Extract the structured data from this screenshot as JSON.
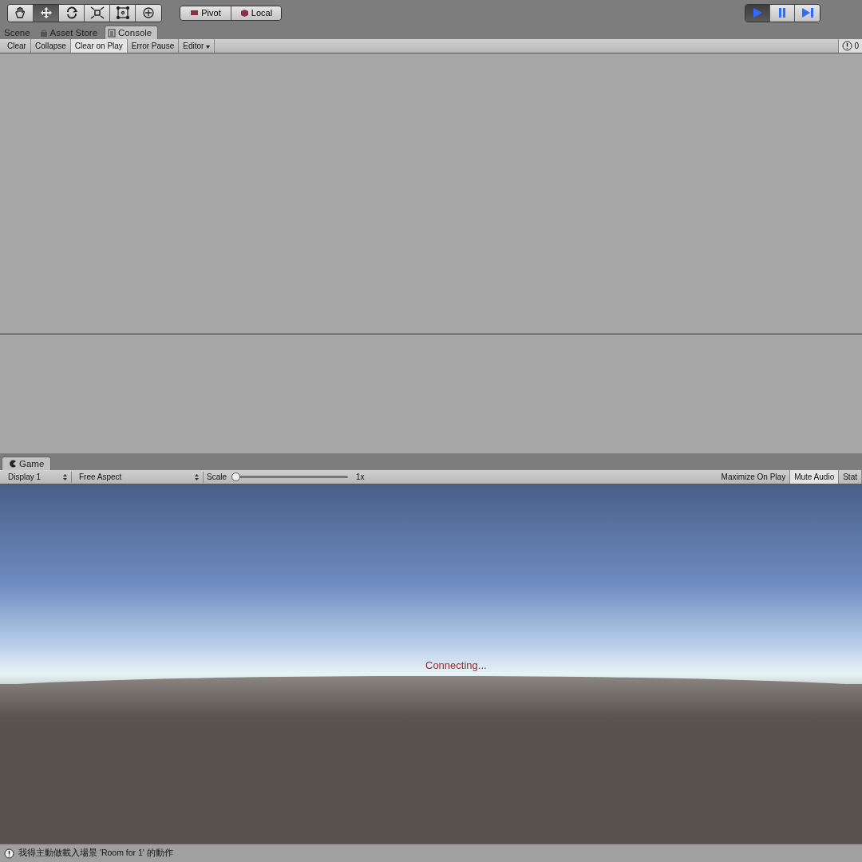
{
  "toolbar": {
    "tools": [
      {
        "kind": "hand",
        "selected": false
      },
      {
        "kind": "move",
        "selected": true
      },
      {
        "kind": "rotate",
        "selected": false
      },
      {
        "kind": "scale",
        "selected": false
      },
      {
        "kind": "rect",
        "selected": false
      },
      {
        "kind": "transform",
        "selected": false
      }
    ],
    "pivot_buttons": [
      {
        "kind": "pivot",
        "label": "Pivot"
      },
      {
        "kind": "local",
        "label": "Local"
      }
    ],
    "play_controls": [
      {
        "kind": "play",
        "selected": true
      },
      {
        "kind": "pause",
        "selected": false
      },
      {
        "kind": "step",
        "selected": false
      }
    ]
  },
  "tabs": [
    {
      "label": "Scene",
      "kind": "plain",
      "selected": false
    },
    {
      "label": "Asset Store",
      "kind": "store",
      "selected": false
    },
    {
      "label": "Console",
      "kind": "console",
      "selected": true
    }
  ],
  "console_toolbar": {
    "buttons": [
      {
        "label": "Clear",
        "on": false
      },
      {
        "label": "Collapse",
        "on": false
      },
      {
        "label": "Clear on Play",
        "on": true
      },
      {
        "label": "Error Pause",
        "on": false
      }
    ],
    "dropdown": "Editor",
    "error_count": "0"
  },
  "game": {
    "tab": "Game",
    "display": "Display 1",
    "aspect": "Free Aspect",
    "scale_label": "Scale",
    "scale": {
      "level": 0
    },
    "scale_reading": "1x",
    "toggles": [
      {
        "label": "Maximize On Play",
        "on": false
      },
      {
        "label": "Mute Audio",
        "on": true
      },
      {
        "label": "Stat",
        "on": false
      }
    ],
    "message": "Connecting..."
  },
  "status_bar": {
    "message": "我得主動做載入場景 'Room for 1' 的動作"
  }
}
